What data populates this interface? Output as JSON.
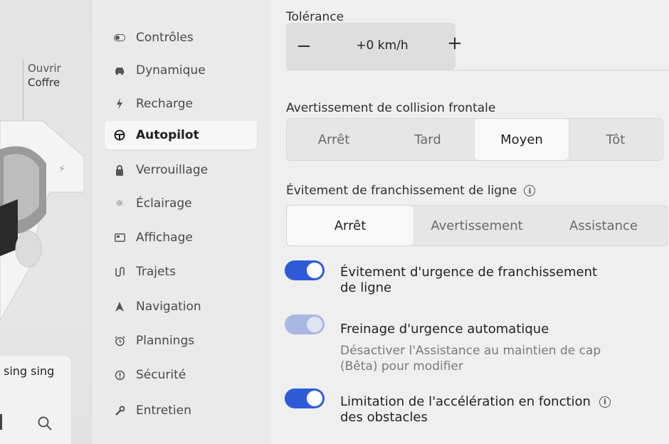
{
  "car_pane": {
    "trunk_line1": "Ouvrir",
    "trunk_line2": "Coffre",
    "media_title": "sing sing"
  },
  "nav": {
    "items": [
      {
        "label": "Contrôles",
        "icon": "toggle-icon"
      },
      {
        "label": "Dynamique",
        "icon": "car-icon"
      },
      {
        "label": "Recharge",
        "icon": "bolt-icon"
      },
      {
        "label": "Autopilot",
        "icon": "steering-wheel-icon",
        "active": true
      },
      {
        "label": "Verrouillage",
        "icon": "lock-icon"
      },
      {
        "label": "Éclairage",
        "icon": "sun-icon"
      },
      {
        "label": "Affichage",
        "icon": "display-icon"
      },
      {
        "label": "Trajets",
        "icon": "trips-icon"
      },
      {
        "label": "Navigation",
        "icon": "navigation-arrow-icon"
      },
      {
        "label": "Plannings",
        "icon": "clock-icon"
      },
      {
        "label": "Sécurité",
        "icon": "safety-icon"
      },
      {
        "label": "Entretien",
        "icon": "wrench-icon"
      }
    ]
  },
  "tolerance": {
    "label": "Tolérance",
    "value": "+0 km/h",
    "minus": "−",
    "plus": "+"
  },
  "fcw": {
    "label": "Avertissement de collision frontale",
    "options": [
      "Arrêt",
      "Tard",
      "Moyen",
      "Tôt"
    ],
    "selected": "Moyen"
  },
  "lane_departure": {
    "label": "Évitement de franchissement de ligne",
    "options": [
      "Arrêt",
      "Avertissement",
      "Assistance"
    ],
    "selected": "Arrêt"
  },
  "toggles": [
    {
      "title_line1": "Évitement d'urgence de franchissement",
      "title_line2": "de ligne",
      "on": true,
      "disabled": false
    },
    {
      "title_line1": "Freinage d'urgence automatique",
      "sub_line1": "Désactiver l'Assistance au maintien de cap",
      "sub_line2": "(Bêta) pour modifier",
      "on": true,
      "disabled": true
    },
    {
      "title_line1": "Limitation de l'accélération en fonction",
      "title_line2": "des obstacles",
      "on": true,
      "disabled": false
    }
  ],
  "colors": {
    "toggle_on": "#2f5bd8",
    "toggle_disabled": "#a9b8e2"
  }
}
